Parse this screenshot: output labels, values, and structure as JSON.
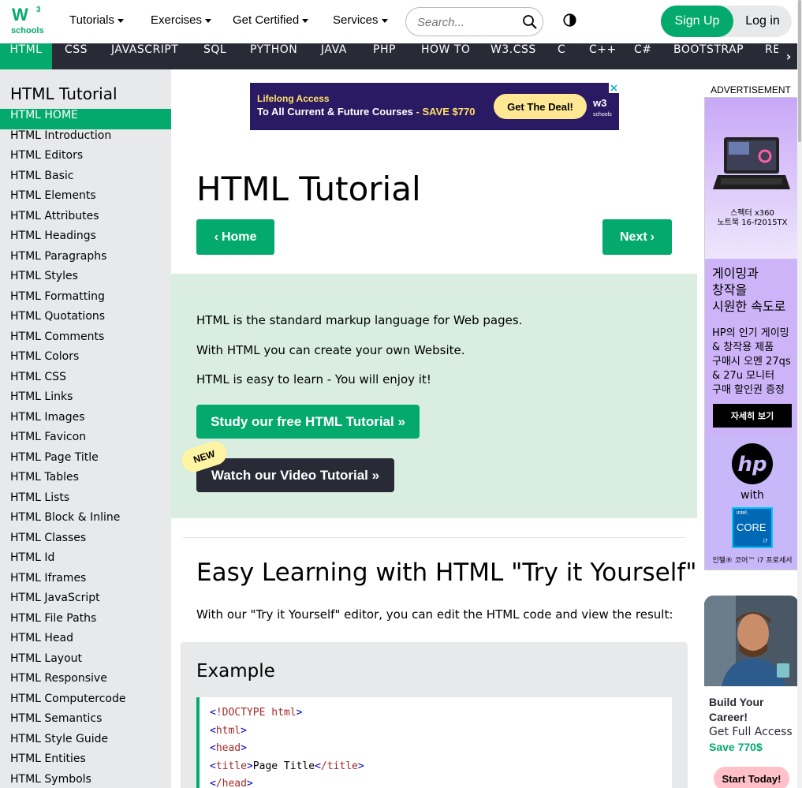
{
  "brand": {
    "logo_main": "W",
    "logo_sup": "3",
    "logo_sub": "schools",
    "accent": "#04AA6D",
    "dark": "#282A35"
  },
  "topnav": {
    "menus": [
      "Tutorials",
      "Exercises",
      "Get Certified",
      "Services"
    ],
    "search_placeholder": "Search...",
    "signup_label": "Sign Up",
    "login_label": "Log in"
  },
  "subjects": [
    "HTML",
    "CSS",
    "JAVASCRIPT",
    "SQL",
    "PYTHON",
    "JAVA",
    "PHP",
    "HOW TO",
    "W3.CSS",
    "C",
    "C++",
    "C#",
    "BOOTSTRAP",
    "RE"
  ],
  "subjects_active": "HTML",
  "sidebar": {
    "title": "HTML Tutorial",
    "items": [
      "HTML HOME",
      "HTML Introduction",
      "HTML Editors",
      "HTML Basic",
      "HTML Elements",
      "HTML Attributes",
      "HTML Headings",
      "HTML Paragraphs",
      "HTML Styles",
      "HTML Formatting",
      "HTML Quotations",
      "HTML Comments",
      "HTML Colors",
      "HTML CSS",
      "HTML Links",
      "HTML Images",
      "HTML Favicon",
      "HTML Page Title",
      "HTML Tables",
      "HTML Lists",
      "HTML Block & Inline",
      "HTML Classes",
      "HTML Id",
      "HTML Iframes",
      "HTML JavaScript",
      "HTML File Paths",
      "HTML Head",
      "HTML Layout",
      "HTML Responsive",
      "HTML Computercode",
      "HTML Semantics",
      "HTML Style Guide",
      "HTML Entities",
      "HTML Symbols"
    ],
    "active_index": 0
  },
  "banner_ad": {
    "line1": "Lifelong Access",
    "line2": "To All Current & Future Courses",
    "save": "- SAVE $770",
    "cta": "Get The Deal!",
    "logo": "w3",
    "logo_sub": "schools"
  },
  "main": {
    "title": "HTML Tutorial",
    "home_label": "Home",
    "next_label": "Next",
    "intro": [
      "HTML is the standard markup language for Web pages.",
      "With HTML you can create your own Website.",
      "HTML is easy to learn - You will enjoy it!"
    ],
    "study_button": "Study our free HTML Tutorial »",
    "new_badge": "NEW",
    "video_button": "Watch our Video Tutorial »",
    "section_heading": "Easy Learning with HTML \"Try it Yourself\"",
    "section_text": "With our \"Try it Yourself\" editor, you can edit the HTML code and view the result:",
    "example_title": "Example"
  },
  "code": [
    {
      "open": "<",
      "tag": "!DOCTYPE",
      "attr": " html",
      "close": ">",
      "text": "",
      "end": ""
    },
    {
      "open": "<",
      "tag": "html",
      "attr": "",
      "close": ">",
      "text": "",
      "end": ""
    },
    {
      "open": "<",
      "tag": "head",
      "attr": "",
      "close": ">",
      "text": "",
      "end": ""
    },
    {
      "open": "<",
      "tag": "title",
      "attr": "",
      "close": ">",
      "text": "Page Title",
      "end": "/title"
    },
    {
      "open": "<",
      "tag": "/head",
      "attr": "",
      "close": ">",
      "text": "",
      "end": ""
    }
  ],
  "right_ad": {
    "label": "ADVERTISEMENT",
    "caption1": "스펙터 x360\n노트북 16-f2015TX",
    "headline": "게이밍과\n창작을\n시원한 속도로",
    "body": "HP의 인기 게이밍\n& 창작용 제품\n구매시 오멘 27qs\n& 27u 모니터\n구매 할인권 증정",
    "cta": "자세히 보기",
    "with": "with",
    "intel_top": "intel.",
    "intel_mid": "CORE",
    "intel_gen": "i7",
    "caption3": "인텔® 코어™ i7 프로세서"
  },
  "promo": {
    "title": "Build Your\nCareer!",
    "sub": "Get Full Access",
    "save": "Save 770$",
    "cta": "Start Today!"
  }
}
